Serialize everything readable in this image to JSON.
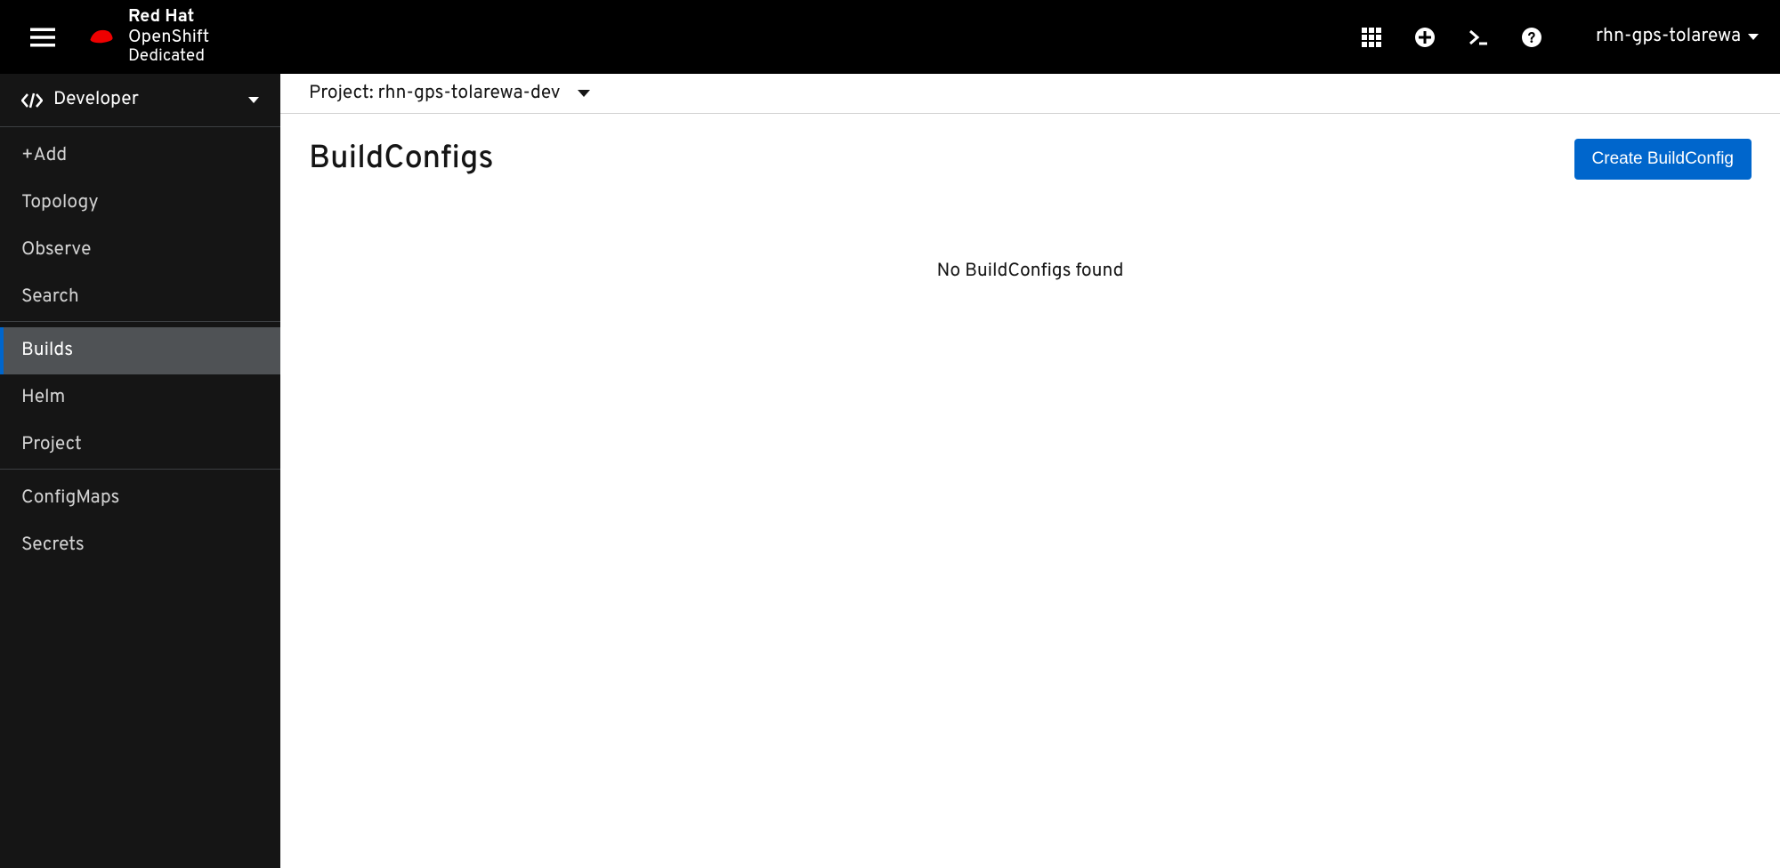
{
  "header": {
    "brand_line1_bold": "Red Hat",
    "brand_line2": "OpenShift",
    "brand_line3": "Dedicated",
    "username": "rhn-gps-tolarewa"
  },
  "sidebar": {
    "perspective": "Developer",
    "sections": [
      {
        "items": [
          "+Add",
          "Topology",
          "Observe",
          "Search"
        ]
      },
      {
        "items": [
          "Builds",
          "Helm",
          "Project"
        ]
      },
      {
        "items": [
          "ConfigMaps",
          "Secrets"
        ]
      }
    ],
    "active": "Builds"
  },
  "project": {
    "label_prefix": "Project:",
    "name": "rhn-gps-tolarewa-dev"
  },
  "main": {
    "title": "BuildConfigs",
    "create_button": "Create BuildConfig",
    "empty_message": "No BuildConfigs found"
  }
}
